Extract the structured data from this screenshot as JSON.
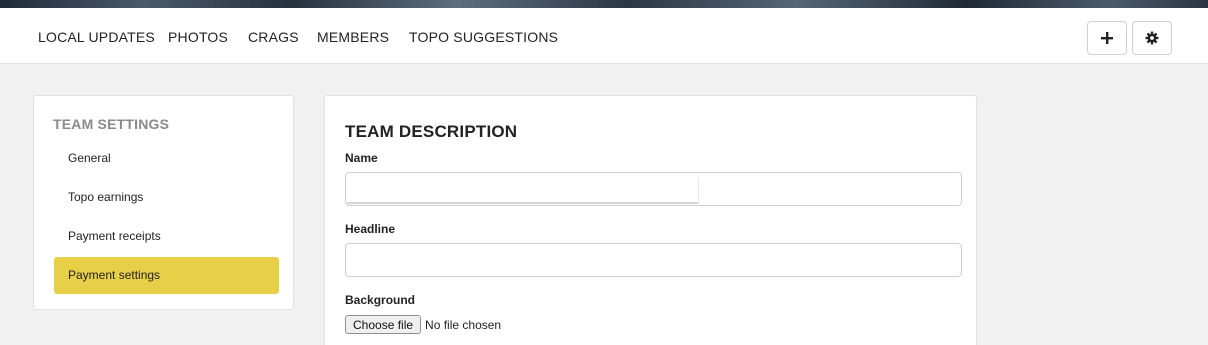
{
  "nav": {
    "items": [
      "LOCAL UPDATES",
      "PHOTOS",
      "CRAGS",
      "MEMBERS",
      "TOPO SUGGESTIONS"
    ],
    "add_icon": "plus-icon",
    "settings_icon": "gear-icon"
  },
  "sidebar": {
    "title": "TEAM SETTINGS",
    "items": [
      {
        "label": "General",
        "active": false
      },
      {
        "label": "Topo earnings",
        "active": false
      },
      {
        "label": "Payment receipts",
        "active": false
      },
      {
        "label": "Payment settings",
        "active": true
      }
    ],
    "active_color": "#e8cf48"
  },
  "form": {
    "title": "TEAM DESCRIPTION",
    "name": {
      "label": "Name",
      "value": ""
    },
    "headline": {
      "label": "Headline",
      "value": ""
    },
    "background": {
      "label": "Background",
      "button_label": "Choose file",
      "status": "No file chosen"
    }
  }
}
